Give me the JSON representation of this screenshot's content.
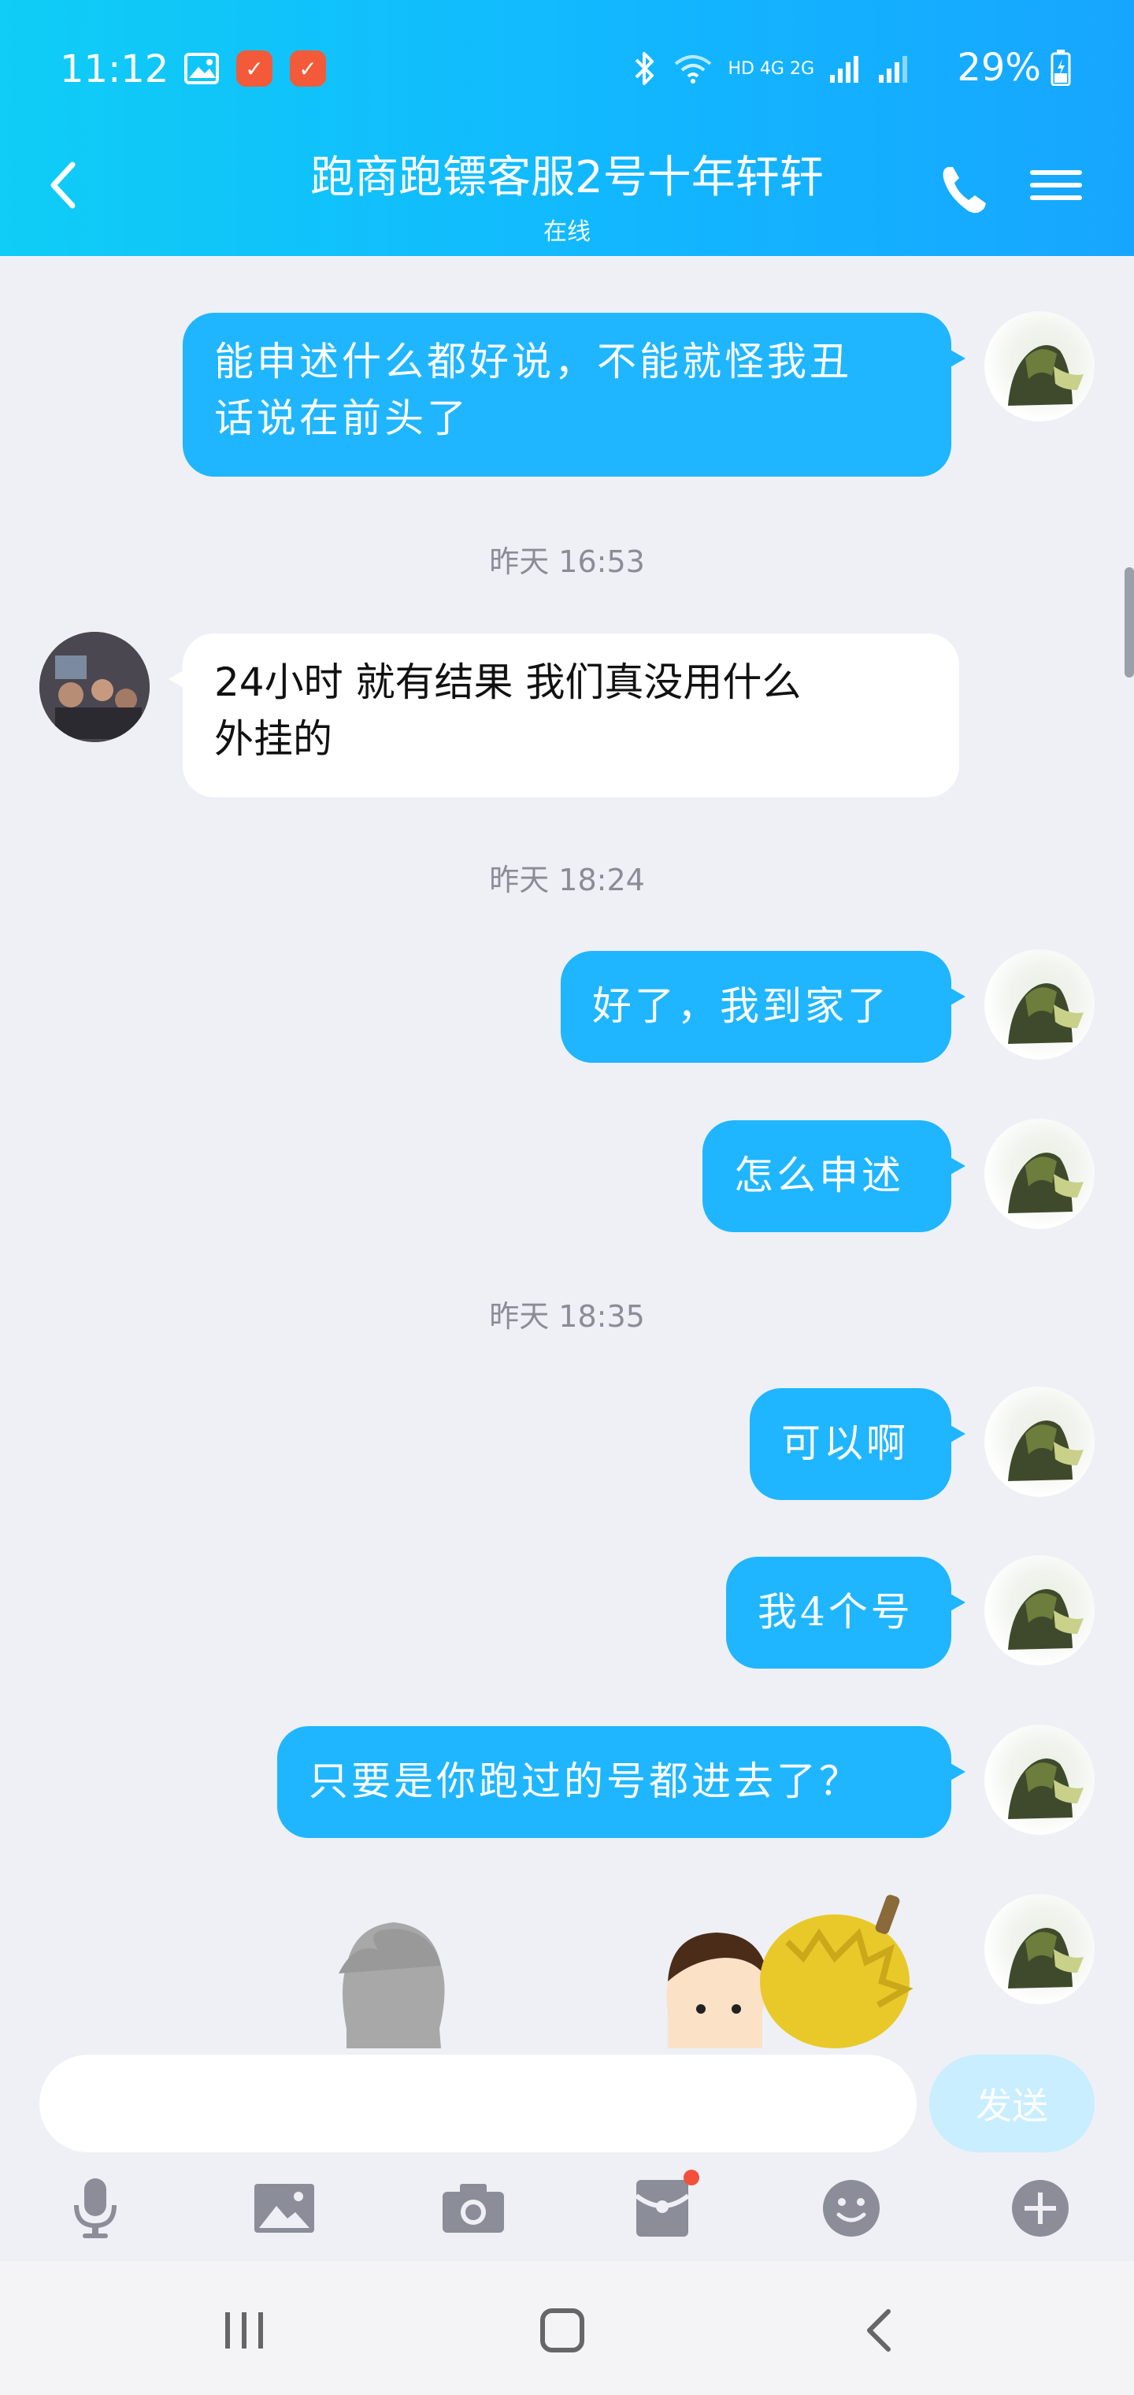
{
  "status_bar": {
    "time": "11:12",
    "network": "HD 4G 2G",
    "battery": "29%"
  },
  "header": {
    "title": "跑商跑镖客服2号十年轩轩",
    "subtitle": "在线"
  },
  "messages": [
    {
      "side": "out",
      "text1": "能申述什么都好说，不能就怪我丑",
      "text2": "话说在前头了"
    },
    {
      "timestamp": "昨天 16:53"
    },
    {
      "side": "in",
      "text1": "24小时  就有结果  我们真没用什么",
      "text2": "外挂的"
    },
    {
      "timestamp": "昨天 18:24"
    },
    {
      "side": "out",
      "text": "好了，我到家了"
    },
    {
      "side": "out",
      "text": "怎么申述"
    },
    {
      "timestamp": "昨天 18:35"
    },
    {
      "side": "out",
      "text": "可以啊"
    },
    {
      "side": "out",
      "text": "我4个号"
    },
    {
      "side": "out",
      "text": "只要是你跑过的号都进去了？"
    }
  ],
  "input": {
    "placeholder": "",
    "send_label": "发送"
  },
  "toolbar": {
    "icons": [
      "microphone-icon",
      "image-icon",
      "camera-icon",
      "red-packet-icon",
      "emoji-icon",
      "plus-icon"
    ]
  },
  "colors": {
    "header_gradient_start": "#0fcdf6",
    "header_gradient_end": "#17a6ff",
    "outgoing_bubble": "#1fb6ff",
    "incoming_bubble": "#ffffff",
    "background": "#eef0f6",
    "send_button_disabled": "#c8eeff"
  }
}
